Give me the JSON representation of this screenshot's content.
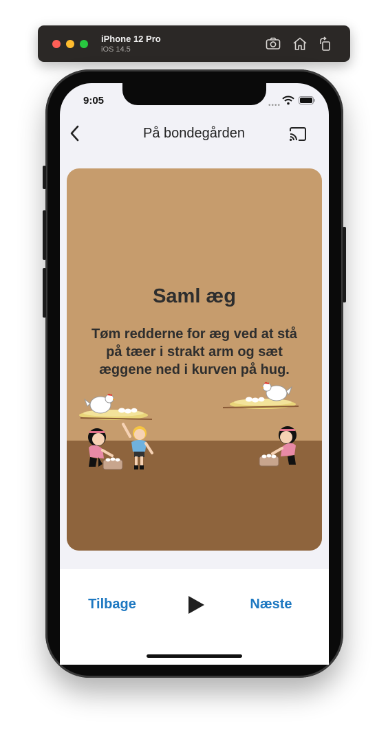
{
  "simulator": {
    "device_name": "iPhone 12 Pro",
    "os_version": "iOS 14.5",
    "icons": [
      "screenshot-icon",
      "home-icon",
      "rotate-icon"
    ]
  },
  "status_bar": {
    "time": "9:05",
    "icons": [
      "cellular-dots-icon",
      "wifi-icon",
      "battery-icon"
    ]
  },
  "nav": {
    "title": "På bondegården",
    "back_icon": "chevron-left-icon",
    "cast_icon": "cast-icon"
  },
  "card": {
    "title": "Saml æg",
    "description": "Tøm redderne for æg ved at stå på tæer i strakt arm og sæt æggene ned i kurven på hug.",
    "colors": {
      "sky": "#c69c6d",
      "ground": "#8e643d"
    }
  },
  "bottom": {
    "back_label": "Tilbage",
    "next_label": "Næste",
    "play_icon": "play-icon",
    "accent": "#1d78c1"
  }
}
